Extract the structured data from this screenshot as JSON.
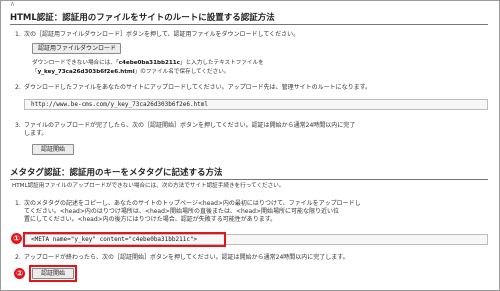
{
  "top_glyph": "∧",
  "html_auth": {
    "title": "HTML認証：認証用のファイルをサイトのルートに設置する認証方法",
    "step1_num": "1.",
    "step1_text": "次の［認証用ファイルダウンロード］ボタンを押して、認証用ファイルをダウンロードしてください。",
    "download_button": "認証用ファイルダウンロード",
    "note1_pre": "ダウンロードできない場合には、「",
    "note1_key": "c4ebe0ba31bb211c",
    "note1_post": "」と入力したテキストファイルを",
    "note2_pre": "「",
    "note2_file": "y_key_73ca26d303b6f2e6.html",
    "note2_post": "」のファイル名で保存してください。",
    "step2_num": "2.",
    "step2_text": "ダウンロードしたファイルをあなたのサイトにアップロードしてください。アップロード先は、管理サイトのルートになります。",
    "url": "http://www.be-cms.com/y_key_73ca26d303b6f2e6.html",
    "step3_num": "3.",
    "step3_text_1": "ファイルのアップロードが完了したら、次の［認証開始］ボタンを押してください。認証は開始から通常24時間以内に完了",
    "step3_text_2": "します。",
    "start_button": "認証開始"
  },
  "meta_auth": {
    "title": "メタタグ認証：認証用のキーをメタタグに記述する方法",
    "intro": "HTML認証用ファイルのアップロードができない場合には、次の方法でサイト認証手続きを行ってください。",
    "step1_num": "1.",
    "step1_line1": "次のメタタグの記述をコピーし、あなたのサイトのトップページ<head>内の最初にはりつけて、ファイルをアップロードし",
    "step1_line2": "てください。<head>内のはりつけ場所は、<head>開始場所の直後または、<head>開始場所に可能な限り近い位",
    "step1_line3": "置にしてください。<head>内の後方にはりつけた場合、認証が失敗する可能性があります。",
    "meta_tag": "<META name=\"y_key\" content=\"c4ebe0ba31bb211c\">",
    "step2_num": "2.",
    "step2_text": "アップロードが終わったら、次の［認証開始］ボタンを押してください。認証は開始から通常24時間以内に完了します。",
    "start_button": "認証開始",
    "marker1": "①",
    "marker2": "②"
  },
  "colors": {
    "highlight": "#e5141b",
    "divider": "#777777",
    "button_bg": "#ececec"
  }
}
